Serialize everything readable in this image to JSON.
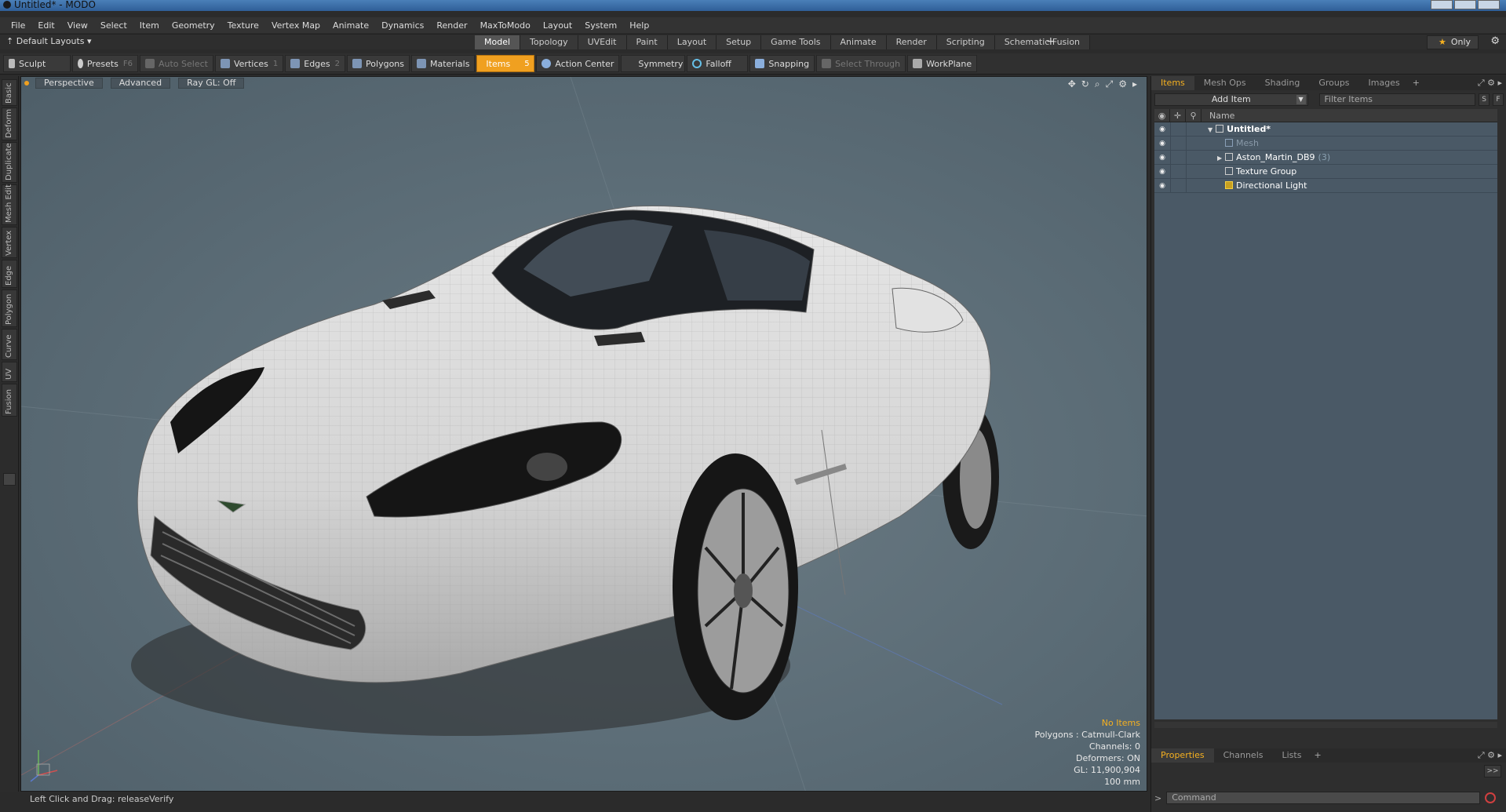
{
  "window": {
    "title": "Untitled* - MODO"
  },
  "menubar": [
    "File",
    "Edit",
    "View",
    "Select",
    "Item",
    "Geometry",
    "Texture",
    "Vertex Map",
    "Animate",
    "Dynamics",
    "Render",
    "MaxToModo",
    "Layout",
    "System",
    "Help"
  ],
  "layoutbar": {
    "layouts_label": "Default Layouts ▾",
    "tabs": [
      "Model",
      "Topology",
      "UVEdit",
      "Paint",
      "Layout",
      "Setup",
      "Game Tools",
      "Animate",
      "Render",
      "Scripting",
      "Schematic Fusion"
    ],
    "active_tab": "Model",
    "plus": "+",
    "only_label": "Only"
  },
  "toolbar": {
    "sculpt": "Sculpt",
    "presets": "Presets",
    "presets_key": "F6",
    "auto_select": "Auto Select",
    "vertices": "Vertices",
    "vertices_key": "1",
    "edges": "Edges",
    "edges_key": "2",
    "polygons": "Polygons",
    "materials": "Materials",
    "items": "Items",
    "items_key": "5",
    "action_center": "Action Center",
    "symmetry": "Symmetry",
    "falloff": "Falloff",
    "snapping": "Snapping",
    "select_through": "Select Through",
    "workplane": "WorkPlane"
  },
  "lefttabs": [
    "Basic",
    "Deform",
    "Duplicate",
    "Mesh Edit",
    "Vertex",
    "Edge",
    "Polygon",
    "Curve",
    "UV",
    "Fusion"
  ],
  "viewport": {
    "perspective": "Perspective",
    "advanced": "Advanced",
    "raygl": "Ray GL: Off",
    "info": {
      "no_items": "No Items",
      "polygons": "Polygons : Catmull-Clark",
      "channels": "Channels: 0",
      "deformers": "Deformers: ON",
      "gl": "GL: 11,900,904",
      "scale": "100 mm"
    }
  },
  "statusbar": {
    "text": "Left Click and Drag:   releaseVerify"
  },
  "rightpanel": {
    "top_tabs": [
      "Items",
      "Mesh Ops",
      "Shading",
      "Groups",
      "Images"
    ],
    "active_top": "Items",
    "add_item": "Add Item",
    "filter_placeholder": "Filter Items",
    "s_btn": "S",
    "f_btn": "F",
    "name_col": "Name",
    "items": [
      {
        "label": "Untitled*",
        "style": "bold"
      },
      {
        "label": "Mesh",
        "style": "dim"
      },
      {
        "label": "Aston_Martin_DB9",
        "count": "(3)"
      },
      {
        "label": "Texture Group"
      },
      {
        "label": "Directional Light"
      }
    ],
    "bottom_tabs": [
      "Properties",
      "Channels",
      "Lists"
    ],
    "active_bottom": "Properties",
    "command_placeholder": "Command",
    "expand_btn": ">>"
  }
}
